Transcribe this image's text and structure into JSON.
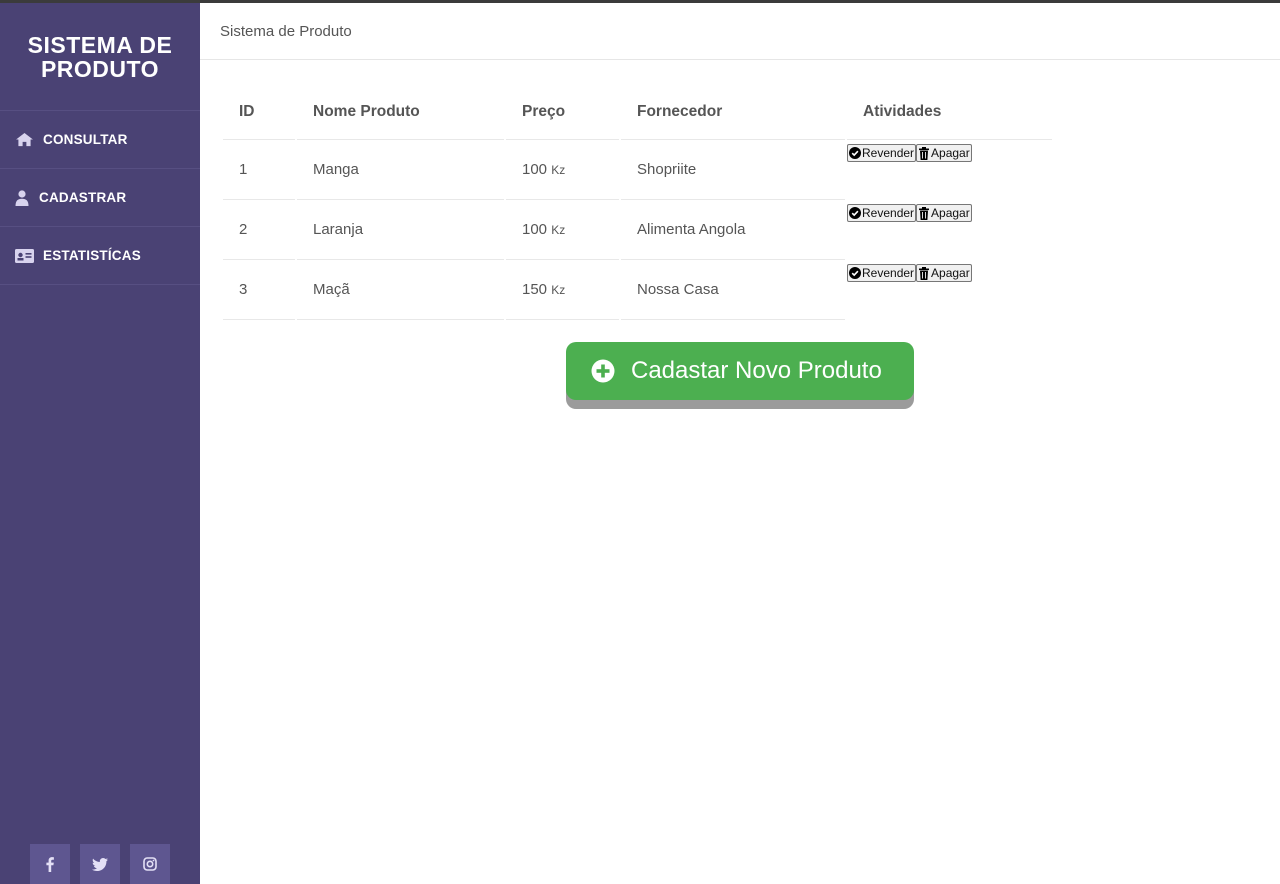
{
  "sidebar": {
    "brand_line1": "SISTEMA DE",
    "brand_line2": "PRODUTO",
    "items": [
      {
        "label": "CONSULTAR",
        "icon": "home-icon"
      },
      {
        "label": "CADASTRAR",
        "icon": "user-icon"
      },
      {
        "label": "ESTATISTÍCAS",
        "icon": "id-card-icon"
      }
    ],
    "social": [
      {
        "label": "f",
        "icon": "facebook-icon"
      },
      {
        "label": "🐦",
        "icon": "twitter-icon"
      },
      {
        "label": "◎",
        "icon": "instagram-icon"
      }
    ]
  },
  "breadcrumb": "Sistema de Produto",
  "table": {
    "headers": [
      "ID",
      "Nome Produto",
      "Preço",
      "Fornecedor",
      "Atividades"
    ],
    "rows": [
      {
        "id": "1",
        "name": "Manga",
        "price": "100",
        "currency": "Kz",
        "supplier": "Shopriite"
      },
      {
        "id": "2",
        "name": "Laranja",
        "price": "100",
        "currency": "Kz",
        "supplier": "Alimenta Angola"
      },
      {
        "id": "3",
        "name": "Maçã",
        "price": "150",
        "currency": "Kz",
        "supplier": "Nossa Casa"
      }
    ],
    "resell_label": "Revender",
    "delete_label": "Apagar"
  },
  "cta": {
    "label": "Cadastar Novo Produto",
    "icon": "plus-circle-icon"
  },
  "colors": {
    "sidebar": "#4a4274",
    "cta": "#4caf50"
  }
}
